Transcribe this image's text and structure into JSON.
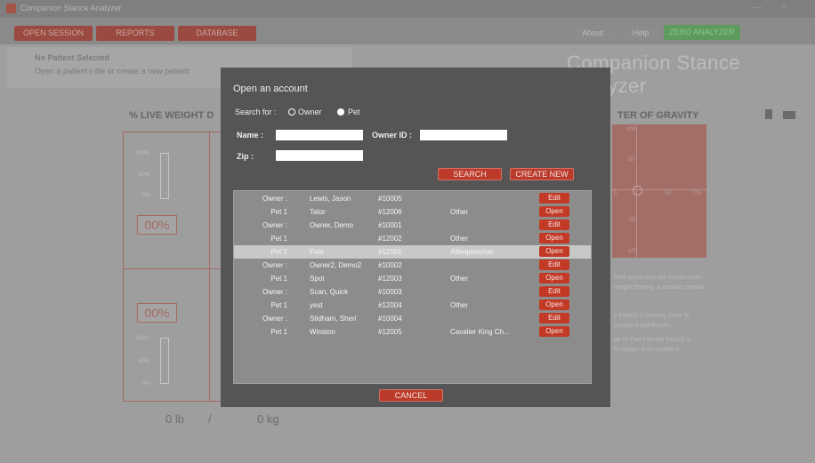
{
  "window": {
    "title": "Companion Stance Analyzer",
    "minimize": "—",
    "close": "○"
  },
  "nav": {
    "open_session": "OPEN SESSION",
    "reports": "REPORTS",
    "database": "DATABASE"
  },
  "header": {
    "about": "About",
    "help": "Help",
    "zero": "ZERO ANALYZER",
    "brand": "Companion Stance Analyzer"
  },
  "patient": {
    "status": "No Patient Selected",
    "hint": "Open a patient's file or create a new patient"
  },
  "panels": {
    "live_weight_title": "% LIVE WEIGHT D",
    "cog_title": "TER OF GRAVITY",
    "top_pct": "00%",
    "bottom_pct": "00%",
    "axis": [
      "100%",
      "50%",
      "0%"
    ],
    "weight_lb": "0 lb",
    "weight_sep": "/",
    "weight_kg": "0 kg",
    "cog_labels": {
      "top": "100",
      "upper": "50",
      "left": "0",
      "right_mid": "50",
      "right": "100",
      "lower": "-50",
      "bottom": "-100"
    },
    "notes": [
      "nted quadrants are visuals cues",
      "weight bearing is outside normal",
      "s limb(s) is bearing more %",
      "standard distribution.",
      "ge or Pad indicate limb(s) is",
      "% weight than standard"
    ]
  },
  "modal": {
    "title": "Open an account",
    "search_for": "Search for :",
    "owner_option": "Owner",
    "pet_option": "Pet",
    "selected_option": "pet",
    "name_label": "Name :",
    "name_value": "",
    "owner_id_label": "Owner ID :",
    "owner_id_value": "",
    "zip_label": "Zip :",
    "zip_value": "",
    "search_btn": "SEARCH",
    "create_btn": "CREATE NEW",
    "cancel_btn": "CANCEL",
    "rows": [
      {
        "type": "Owner :",
        "name": "Lewis, Jason",
        "id": "#10005",
        "breed": "",
        "action": "Edit"
      },
      {
        "type": "Pet 1",
        "name": "Tator",
        "id": "#12006",
        "breed": "Other",
        "action": "Open"
      },
      {
        "type": "Owner :",
        "name": "Owner, Demo",
        "id": "#10001",
        "breed": "",
        "action": "Edit"
      },
      {
        "type": "Pet 1",
        "name": "",
        "id": "#12002",
        "breed": "Other",
        "action": "Open"
      },
      {
        "type": "Pet 2",
        "name": "Fido",
        "id": "#12001",
        "breed": "Affenpinscher",
        "action": "Open"
      },
      {
        "type": "Owner :",
        "name": "Owner2, Demo2",
        "id": "#10002",
        "breed": "",
        "action": "Edit"
      },
      {
        "type": "Pet 1",
        "name": "Spot",
        "id": "#12003",
        "breed": "Other",
        "action": "Open"
      },
      {
        "type": "Owner :",
        "name": "Scan, Quick",
        "id": "#10003",
        "breed": "",
        "action": "Edit"
      },
      {
        "type": "Pet 1",
        "name": "yest",
        "id": "#12004",
        "breed": "Other",
        "action": "Open"
      },
      {
        "type": "Owner :",
        "name": "Stidham, Sheri",
        "id": "#10004",
        "breed": "",
        "action": "Edit"
      },
      {
        "type": "Pet 1",
        "name": "Winston",
        "id": "#12005",
        "breed": "Cavalier King Ch...",
        "action": "Open"
      }
    ]
  }
}
